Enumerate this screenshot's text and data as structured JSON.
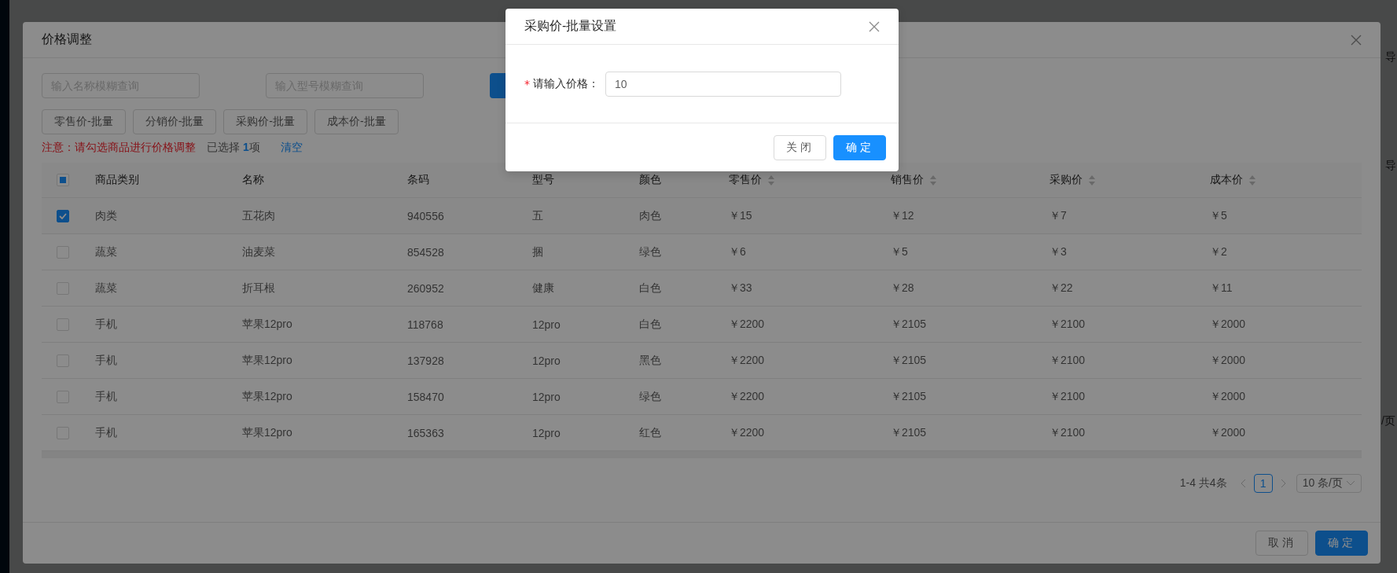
{
  "background": {
    "side_labels": [
      "导",
      "导",
      "/页"
    ]
  },
  "dialog": {
    "title": "价格调整",
    "filters": [
      {
        "placeholder": "输入名称模糊查询"
      },
      {
        "placeholder": "输入型号模糊查询"
      }
    ],
    "batch_buttons": [
      "零售价-批量",
      "分销价-批量",
      "采购价-批量",
      "成本价-批量"
    ],
    "notice": "注意：请勾选商品进行价格调整",
    "selected_label": "已选择",
    "selected_count": "1",
    "selected_unit": "项",
    "clear_link": "清空",
    "table": {
      "select_all": {
        "indeterminate": true
      },
      "columns": [
        {
          "label": "商品类别",
          "sortable": false
        },
        {
          "label": "名称",
          "sortable": false
        },
        {
          "label": "条码",
          "sortable": false
        },
        {
          "label": "型号",
          "sortable": false
        },
        {
          "label": "颜色",
          "sortable": false
        },
        {
          "label": "零售价",
          "sortable": true
        },
        {
          "label": "销售价",
          "sortable": true
        },
        {
          "label": "采购价",
          "sortable": true
        },
        {
          "label": "成本价",
          "sortable": true
        }
      ],
      "rows": [
        {
          "checked": true,
          "cells": [
            "肉类",
            "五花肉",
            "940556",
            "五",
            "肉色",
            "￥15",
            "￥12",
            "￥7",
            "￥5"
          ]
        },
        {
          "checked": false,
          "cells": [
            "蔬菜",
            "油麦菜",
            "854528",
            "捆",
            "绿色",
            "￥6",
            "￥5",
            "￥3",
            "￥2"
          ]
        },
        {
          "checked": false,
          "cells": [
            "蔬菜",
            "折耳根",
            "260952",
            "健康",
            "白色",
            "￥33",
            "￥28",
            "￥22",
            "￥11"
          ]
        },
        {
          "checked": false,
          "cells": [
            "手机",
            "苹果12pro",
            "118768",
            "12pro",
            "白色",
            "￥2200",
            "￥2105",
            "￥2100",
            "￥2000"
          ]
        },
        {
          "checked": false,
          "cells": [
            "手机",
            "苹果12pro",
            "137928",
            "12pro",
            "黑色",
            "￥2200",
            "￥2105",
            "￥2100",
            "￥2000"
          ]
        },
        {
          "checked": false,
          "cells": [
            "手机",
            "苹果12pro",
            "158470",
            "12pro",
            "绿色",
            "￥2200",
            "￥2105",
            "￥2100",
            "￥2000"
          ]
        },
        {
          "checked": false,
          "cells": [
            "手机",
            "苹果12pro",
            "165363",
            "12pro",
            "红色",
            "￥2200",
            "￥2105",
            "￥2100",
            "￥2000"
          ]
        }
      ]
    },
    "pagination": {
      "summary": "1-4 共4条",
      "pages": [
        {
          "label": "1",
          "selected": true
        }
      ],
      "page_size": "10 条/页"
    },
    "footer_buttons": [
      {
        "label": "取消",
        "kind": "default"
      },
      {
        "label": "确定",
        "kind": "primary"
      }
    ]
  },
  "popup": {
    "title": "采购价-批量设置",
    "field": {
      "required_mark": "*",
      "label": "请输入价格：",
      "value": "10"
    },
    "buttons": [
      {
        "label": "关闭",
        "kind": "default"
      },
      {
        "label": "确定",
        "kind": "primary"
      }
    ]
  }
}
